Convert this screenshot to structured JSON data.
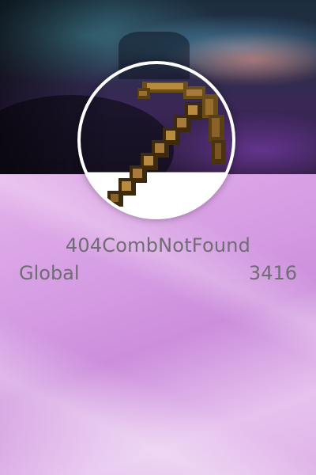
{
  "profile": {
    "username": "404CombNotFound",
    "avatar_icon": "wooden-pickaxe-icon"
  },
  "leaderboard": {
    "scope_label": "Global",
    "value": "3416"
  },
  "colors": {
    "text": "#6e6e72",
    "panel_accent": "#d59ce3",
    "ring": "#ffffff"
  }
}
